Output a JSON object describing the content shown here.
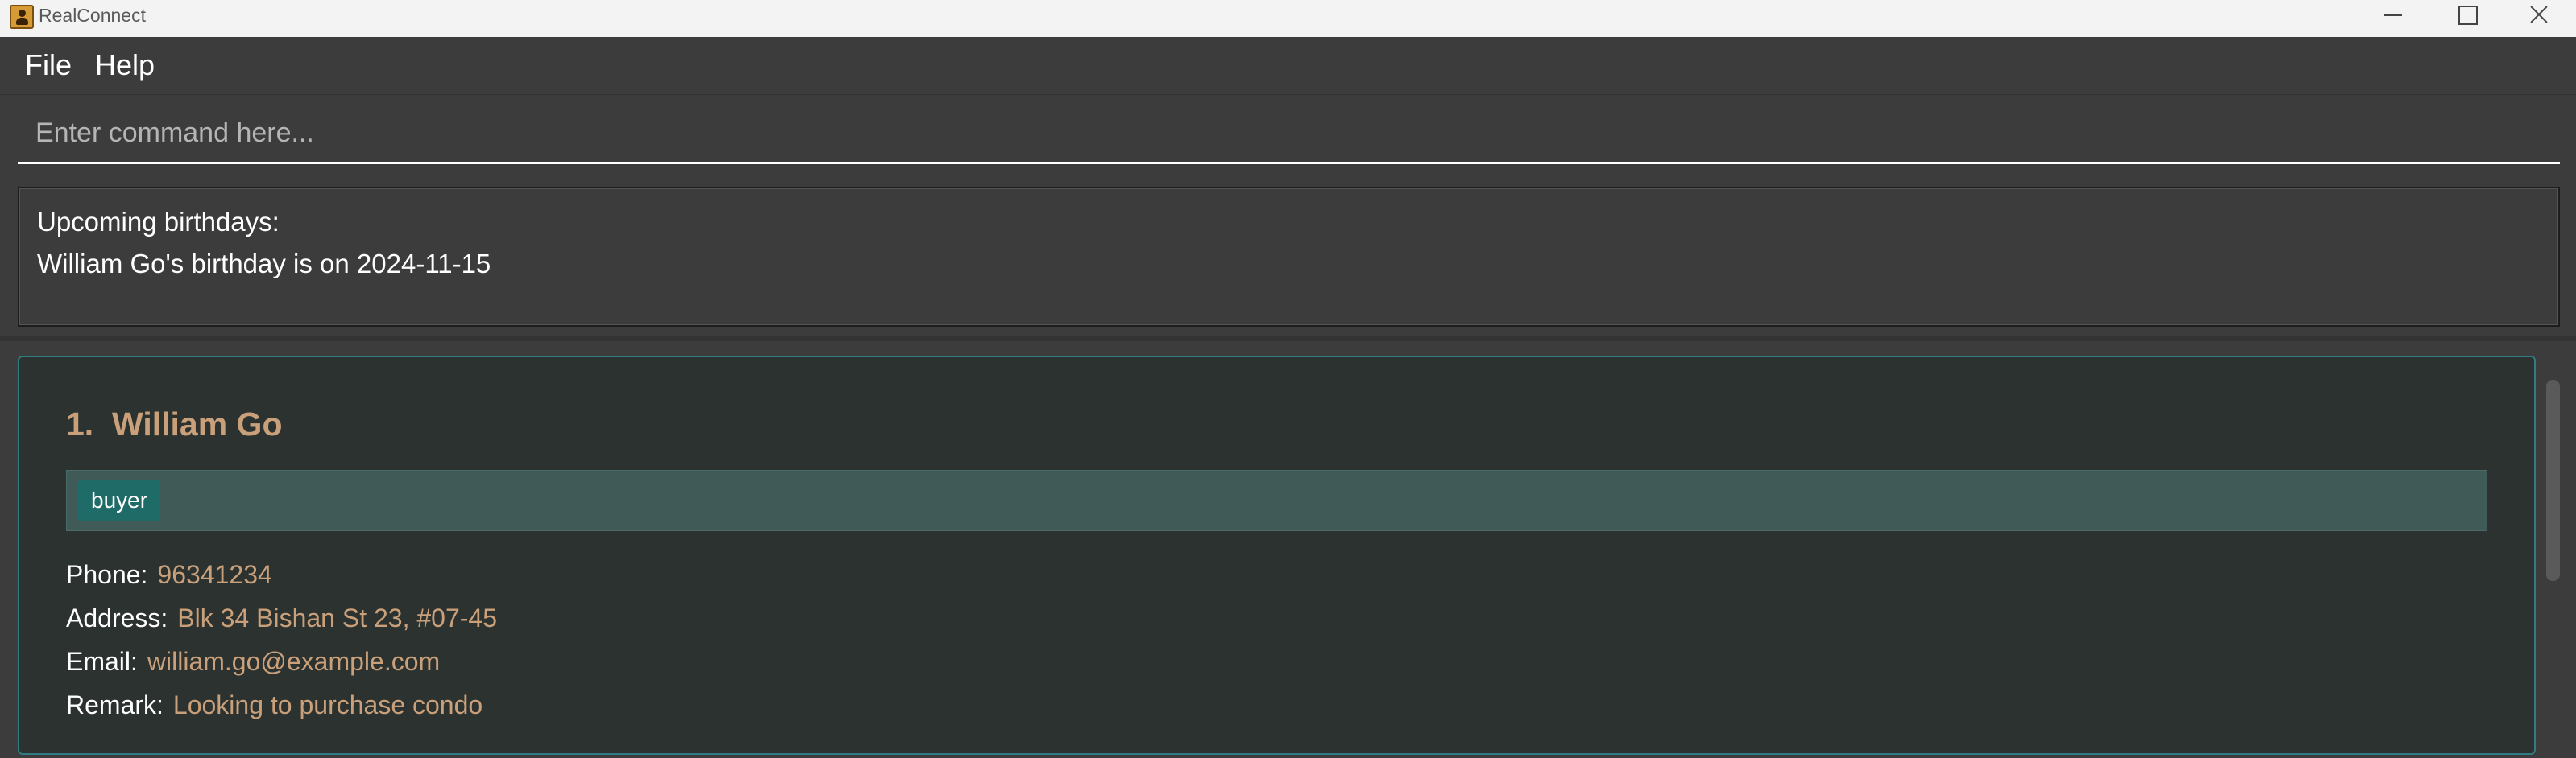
{
  "window": {
    "title": "RealConnect",
    "icons": [
      "app-logo-icon",
      "minimize-icon",
      "maximize-icon",
      "close-icon"
    ]
  },
  "menu": {
    "file_label": "File",
    "help_label": "Help"
  },
  "command": {
    "placeholder": "Enter command here...",
    "value": ""
  },
  "result": {
    "line1": "Upcoming birthdays:",
    "line2": "William Go's birthday is on 2024-11-15"
  },
  "persons": [
    {
      "index": "1.",
      "name": "William Go",
      "tags": [
        "buyer"
      ],
      "phone_label": "Phone:",
      "phone": "96341234",
      "address_label": "Address:",
      "address": "Blk 34 Bishan St 23, #07-45",
      "email_label": "Email:",
      "email": "william.go@example.com",
      "remark_label": "Remark:",
      "remark": "Looking to purchase condo"
    }
  ],
  "colors": {
    "background": "#3c3c3c",
    "card_background": "#2b3230",
    "card_border": "#2f7d82",
    "value_text": "#c9a07a",
    "tag_background": "#1f6b68",
    "tag_row_background": "#3f5a57"
  }
}
